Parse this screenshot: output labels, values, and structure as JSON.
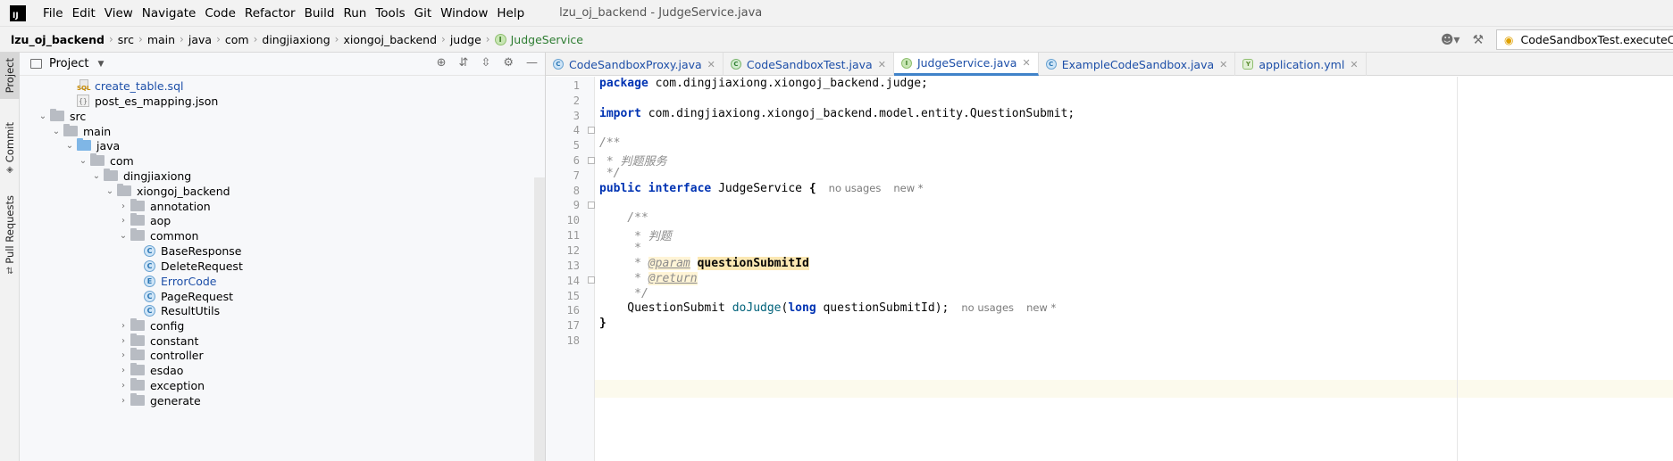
{
  "menubar": {
    "logo": "IJ",
    "items": [
      "File",
      "Edit",
      "View",
      "Navigate",
      "Code",
      "Refactor",
      "Build",
      "Run",
      "Tools",
      "Git",
      "Window",
      "Help"
    ],
    "window_title": "lzu_oj_backend - JudgeService.java"
  },
  "breadcrumbs": [
    "lzu_oj_backend",
    "src",
    "main",
    "java",
    "com",
    "dingjiaxiong",
    "xiongoj_backend",
    "judge",
    "JudgeService"
  ],
  "run_config": {
    "label": "CodeSandboxTest.executeCode"
  },
  "toolstrip": {
    "project": "Project",
    "commit": "Commit",
    "pull_requests": "Pull Requests"
  },
  "project_panel": {
    "title": "Project",
    "tree": [
      {
        "label": "create_table.sql",
        "icon": "sql-file-icon",
        "depth": 3,
        "chev": "",
        "blue": true
      },
      {
        "label": "post_es_mapping.json",
        "icon": "json-file-icon",
        "depth": 3,
        "chev": "",
        "blue": false
      },
      {
        "label": "src",
        "icon": "folder-icon",
        "depth": 1,
        "chev": "open",
        "blue": false
      },
      {
        "label": "main",
        "icon": "folder-icon",
        "depth": 2,
        "chev": "open",
        "blue": false
      },
      {
        "label": "java",
        "icon": "source-folder-icon",
        "depth": 3,
        "chev": "open",
        "blue": false
      },
      {
        "label": "com",
        "icon": "package-icon",
        "depth": 4,
        "chev": "open",
        "blue": false
      },
      {
        "label": "dingjiaxiong",
        "icon": "package-icon",
        "depth": 5,
        "chev": "open",
        "blue": false
      },
      {
        "label": "xiongoj_backend",
        "icon": "package-icon",
        "depth": 6,
        "chev": "open",
        "blue": false
      },
      {
        "label": "annotation",
        "icon": "package-icon",
        "depth": 7,
        "chev": "closed",
        "blue": false
      },
      {
        "label": "aop",
        "icon": "package-icon",
        "depth": 7,
        "chev": "closed",
        "blue": false
      },
      {
        "label": "common",
        "icon": "package-icon",
        "depth": 7,
        "chev": "open",
        "blue": false
      },
      {
        "label": "BaseResponse",
        "icon": "class-icon",
        "badge": "C",
        "depth": 8,
        "chev": "",
        "blue": false
      },
      {
        "label": "DeleteRequest",
        "icon": "class-icon",
        "badge": "C",
        "depth": 8,
        "chev": "",
        "blue": false
      },
      {
        "label": "ErrorCode",
        "icon": "enum-icon",
        "badge": "E",
        "depth": 8,
        "chev": "",
        "blue": true
      },
      {
        "label": "PageRequest",
        "icon": "class-icon",
        "badge": "C",
        "depth": 8,
        "chev": "",
        "blue": false
      },
      {
        "label": "ResultUtils",
        "icon": "class-icon",
        "badge": "C",
        "depth": 8,
        "chev": "",
        "blue": false
      },
      {
        "label": "config",
        "icon": "package-icon",
        "depth": 7,
        "chev": "closed",
        "blue": false
      },
      {
        "label": "constant",
        "icon": "package-icon",
        "depth": 7,
        "chev": "closed",
        "blue": false
      },
      {
        "label": "controller",
        "icon": "package-icon",
        "depth": 7,
        "chev": "closed",
        "blue": false
      },
      {
        "label": "esdao",
        "icon": "package-icon",
        "depth": 7,
        "chev": "closed",
        "blue": false
      },
      {
        "label": "exception",
        "icon": "package-icon",
        "depth": 7,
        "chev": "closed",
        "blue": false
      },
      {
        "label": "generate",
        "icon": "package-icon",
        "depth": 7,
        "chev": "closed",
        "blue": false
      }
    ]
  },
  "tabs": [
    {
      "label": "CodeSandboxProxy.java",
      "icon": "c",
      "badge": "C",
      "active": false
    },
    {
      "label": "CodeSandboxTest.java",
      "icon": "t",
      "badge": "C",
      "active": false
    },
    {
      "label": "JudgeService.java",
      "icon": "i",
      "badge": "I",
      "active": true
    },
    {
      "label": "ExampleCodeSandbox.java",
      "icon": "c",
      "badge": "C",
      "active": false
    },
    {
      "label": "application.yml",
      "icon": "y",
      "badge": "Y",
      "active": false
    }
  ],
  "editor": {
    "line_numbers": [
      "1",
      "2",
      "3",
      "4",
      "5",
      "6",
      "7",
      "8",
      "9",
      "10",
      "11",
      "12",
      "13",
      "14",
      "15",
      "16",
      "17",
      "18"
    ],
    "code": {
      "l1_kw": "package",
      "l1_rest": " com.dingjiaxiong.xiongoj_backend.judge;",
      "l3_kw": "import",
      "l3_rest": " com.dingjiaxiong.xiongoj_backend.model.entity.QuestionSubmit;",
      "l5": "/**",
      "l6": " * 判题服务",
      "l7": " */",
      "l8_kw1": "public",
      "l8_kw2": "interface",
      "l8_name": "JudgeService",
      "l8_brace": " {",
      "l10": "    /**",
      "l11": "     * 判题",
      "l12": "     *",
      "l13_pre": "     * ",
      "l13_tag": "@param",
      "l13_name": "questionSubmitId",
      "l14_pre": "     * ",
      "l14_tag": "@return",
      "l15": "     */",
      "l16_type": "    QuestionSubmit ",
      "l16_meth": "doJudge",
      "l16_open": "(",
      "l16_kw": "long",
      "l16_param": " questionSubmitId);",
      "l17": "}"
    },
    "hints": {
      "usages": "no usages",
      "new": "new *"
    }
  }
}
